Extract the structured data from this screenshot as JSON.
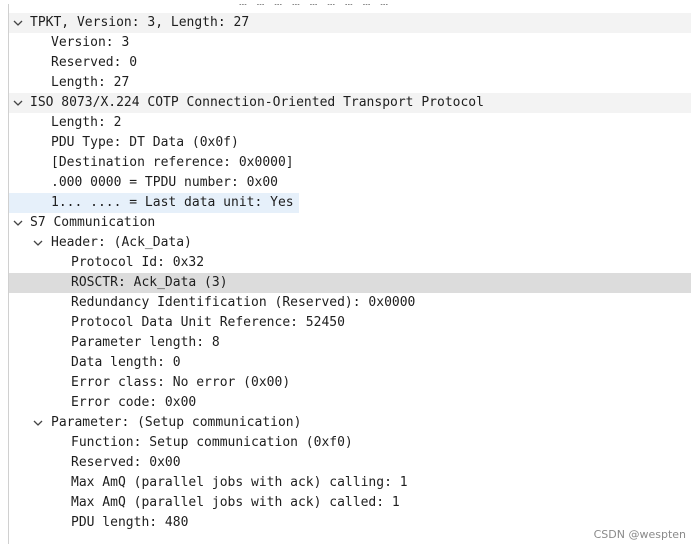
{
  "top_partial": "… … … … … … … … …",
  "tpkt": {
    "header": "TPKT, Version: 3, Length: 27",
    "version": "Version: 3",
    "reserved": "Reserved: 0",
    "length": "Length: 27"
  },
  "cotp": {
    "header": "ISO 8073/X.224 COTP Connection-Oriented Transport Protocol",
    "length": "Length: 2",
    "pdu_type": "PDU Type: DT Data (0x0f)",
    "dest_ref": "[Destination reference: 0x0000]",
    "tpdu_number": ".000 0000 = TPDU number: 0x00",
    "last_data_unit": "1... .... = Last data unit: Yes"
  },
  "s7": {
    "header": "S7 Communication",
    "hdr": {
      "header": "Header: (Ack_Data)",
      "protocol_id": "Protocol Id: 0x32",
      "rosctr": "ROSCTR: Ack_Data (3)",
      "redundancy": "Redundancy Identification (Reserved): 0x0000",
      "pdu_ref": "Protocol Data Unit Reference: 52450",
      "param_length": "Parameter length: 8",
      "data_length": "Data length: 0",
      "error_class": "Error class: No error (0x00)",
      "error_code": "Error code: 0x00"
    },
    "param": {
      "header": "Parameter: (Setup communication)",
      "function": "Function: Setup communication (0xf0)",
      "reserved": "Reserved: 0x00",
      "amq_calling": "Max AmQ (parallel jobs with ack) calling: 1",
      "amq_called": "Max AmQ (parallel jobs with ack) called: 1",
      "pdu_length": "PDU length: 480"
    }
  },
  "watermark": "CSDN @wespten",
  "icons": {
    "expanded": "chevron-down-icon"
  },
  "colors": {
    "selected_blue": "#e6f0fa",
    "selected_gray": "#dcdcdc",
    "group_header": "#f3f3f3"
  }
}
